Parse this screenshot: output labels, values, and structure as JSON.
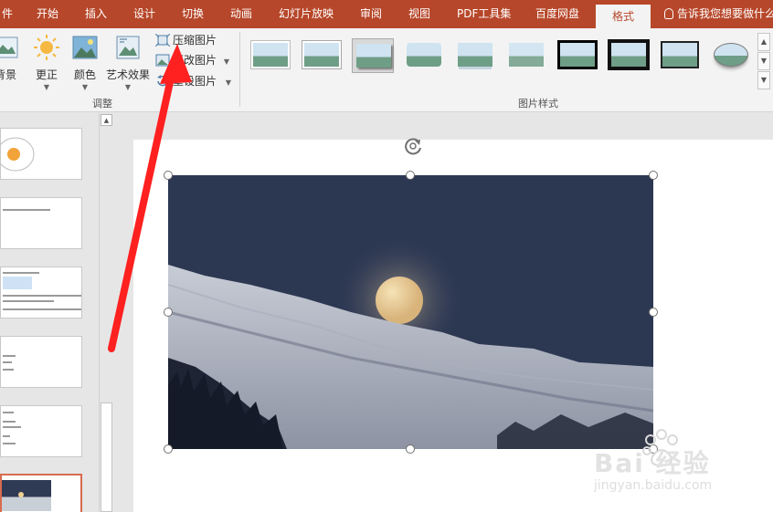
{
  "tabs": [
    {
      "label": "件",
      "active": false
    },
    {
      "label": "开始",
      "active": false
    },
    {
      "label": "插入",
      "active": false
    },
    {
      "label": "设计",
      "active": false
    },
    {
      "label": "切换",
      "active": false
    },
    {
      "label": "动画",
      "active": false
    },
    {
      "label": "幻灯片放映",
      "active": false
    },
    {
      "label": "审阅",
      "active": false
    },
    {
      "label": "视图",
      "active": false
    },
    {
      "label": "PDF工具集",
      "active": false
    },
    {
      "label": "百度网盘",
      "active": false
    },
    {
      "label": "格式",
      "active": true
    }
  ],
  "tell_me": "告诉我您想要做什么",
  "ribbon": {
    "adjust_group": {
      "label": "调整",
      "bg_remove": "背景",
      "corrections": "更正",
      "color": "颜色",
      "artistic": "艺术效果",
      "compress": "压缩图片",
      "change": "更改图片",
      "reset": "重设图片"
    },
    "styles_group": {
      "label": "图片样式"
    }
  },
  "watermark": {
    "brand": "Bai 经验",
    "url": "jingyan.baidu.com"
  },
  "colors": {
    "accent": "#b7472a",
    "arrow": "#ff2020",
    "active_slide_border": "#d76b4e"
  }
}
